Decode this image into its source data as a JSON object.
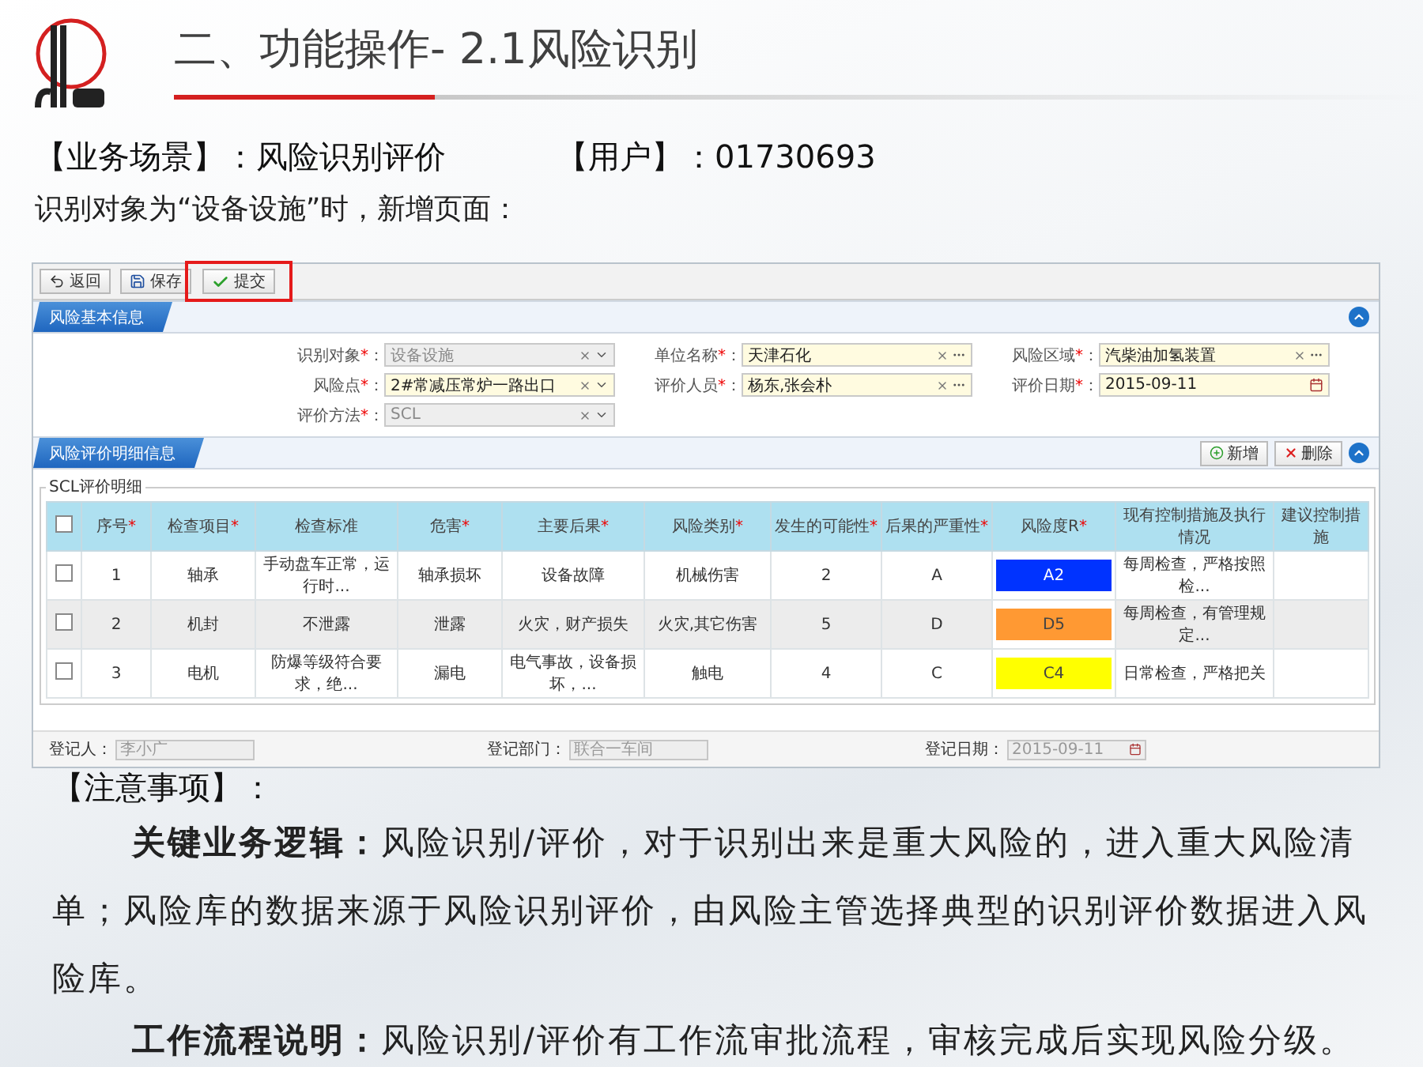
{
  "slide": {
    "title": "二、功能操作- 2.1风险识别",
    "scene_label": "【业务场景】：",
    "scene_value": "风险识别评价",
    "user_label": "【用户】：",
    "user_value": "01730693",
    "intro": "识别对象为“设备设施”时，新增页面：",
    "notes_heading": "【注意事项】：",
    "paragraphs": [
      "**关键业务逻辑：**风险识别/评价，对于识别出来是重大风险的，进入重大风险清单；风险库的数据来源于风险识别评价，由风险主管选择典型的识别评价数据进入风险库。",
      "**工作流程说明：**风险识别/评价有工作流审批流程，审核完成后实现风险分级。"
    ]
  },
  "app": {
    "toolbar": [
      {
        "kind": "back",
        "label": "返回",
        "highlighted": false
      },
      {
        "kind": "save",
        "label": "保存",
        "highlighted": false
      },
      {
        "kind": "submit",
        "label": "提交",
        "highlighted": true
      }
    ],
    "basic_section": {
      "title": "风险基本信息",
      "expanded": true
    },
    "form_rows": [
      [
        {
          "label": "识别对象",
          "mark": "*",
          "colon": "：",
          "value": "设备设施",
          "readonly": true,
          "kind": "select"
        },
        {
          "label": "单位名称",
          "mark": "*",
          "colon": "：",
          "value": "天津石化",
          "readonly": false,
          "kind": "lookup"
        },
        {
          "label": "风险区域",
          "mark": "*",
          "colon": "：",
          "value": "汽柴油加氢装置",
          "readonly": false,
          "kind": "lookup"
        }
      ],
      [
        {
          "label": "风险点",
          "mark": "*",
          "colon": "：",
          "value": "2#常减压常炉一路出口",
          "readonly": false,
          "kind": "select"
        },
        {
          "label": "评价人员",
          "mark": "*",
          "colon": "：",
          "value": "杨东,张会朴",
          "readonly": false,
          "kind": "lookup"
        },
        {
          "label": "评价日期",
          "mark": "*",
          "colon": "：",
          "value": "2015-09-11",
          "readonly": false,
          "kind": "date"
        }
      ],
      [
        {
          "label": "评价方法",
          "mark": "*",
          "colon": "：",
          "value": "SCL",
          "readonly": true,
          "kind": "select"
        }
      ]
    ],
    "detail_section": {
      "title": "风险评价明细信息",
      "expanded": true,
      "buttons": [
        {
          "kind": "add",
          "label": "新增"
        },
        {
          "kind": "delete",
          "label": "删除"
        }
      ]
    },
    "table": {
      "legend": "SCL评价明细",
      "header_checked": false,
      "columns": [
        {
          "label": "序号",
          "mark": "*"
        },
        {
          "label": "检查项目",
          "mark": "*"
        },
        {
          "label": "检查标准"
        },
        {
          "label": "危害",
          "mark": "*"
        },
        {
          "label": "主要后果",
          "mark": "*"
        },
        {
          "label": "风险类别",
          "mark": "*"
        },
        {
          "label": "发生的可能性",
          "mark": "*"
        },
        {
          "label": "后果的严重性",
          "mark": "*"
        },
        {
          "label": "风险度R",
          "mark": "*"
        },
        {
          "label": "现有控制措施及执行情况"
        },
        {
          "label": "建议控制措施"
        }
      ],
      "rows": [
        {
          "checked": false,
          "cells": [
            "1",
            "轴承",
            "手动盘车正常，运行时...",
            "轴承损坏",
            "设备故障",
            "机械伤害",
            "2",
            "A"
          ],
          "risk": "A2",
          "color": "#0033ff",
          "control": "每周检查，严格按照检..."
        },
        {
          "checked": false,
          "cells": [
            "2",
            "机封",
            "不泄露",
            "泄露",
            "火灾，财产损失",
            "火灾,其它伤害",
            "5",
            "D"
          ],
          "risk": "D5",
          "color": "#ff9933",
          "control": "每周检查，有管理规定..."
        },
        {
          "checked": false,
          "cells": [
            "3",
            "电机",
            "防爆等级符合要求，绝...",
            "漏电",
            "电气事故，设备损坏，...",
            "触电",
            "4",
            "C"
          ],
          "risk": "C4",
          "color": "#ffff00",
          "control": "日常检查，严格把关"
        }
      ]
    },
    "footer": [
      {
        "label": "登记人：",
        "value": "李小广",
        "kind": "text"
      },
      {
        "label": "登记部门：",
        "value": "联合一车间",
        "kind": "text"
      },
      {
        "label": "登记日期：",
        "value": "2015-09-11",
        "kind": "date"
      }
    ]
  }
}
